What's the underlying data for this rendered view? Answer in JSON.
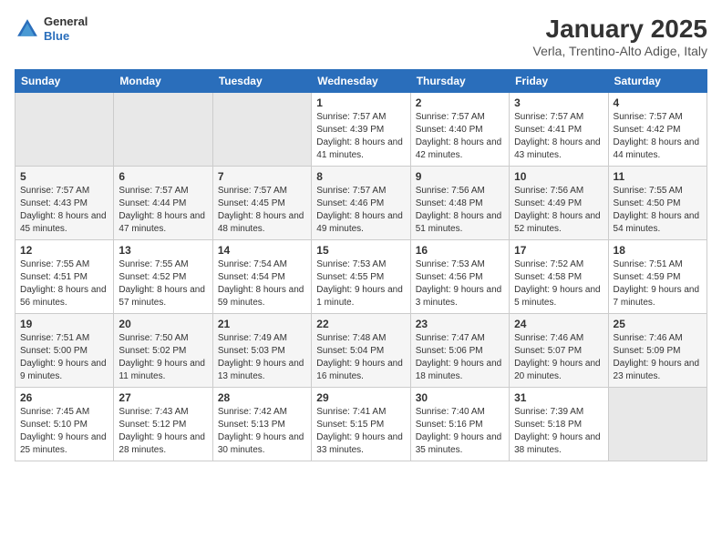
{
  "header": {
    "logo_line1": "General",
    "logo_line2": "Blue",
    "month": "January 2025",
    "location": "Verla, Trentino-Alto Adige, Italy"
  },
  "weekdays": [
    "Sunday",
    "Monday",
    "Tuesday",
    "Wednesday",
    "Thursday",
    "Friday",
    "Saturday"
  ],
  "weeks": [
    [
      {
        "day": "",
        "info": ""
      },
      {
        "day": "",
        "info": ""
      },
      {
        "day": "",
        "info": ""
      },
      {
        "day": "1",
        "info": "Sunrise: 7:57 AM\nSunset: 4:39 PM\nDaylight: 8 hours and 41 minutes."
      },
      {
        "day": "2",
        "info": "Sunrise: 7:57 AM\nSunset: 4:40 PM\nDaylight: 8 hours and 42 minutes."
      },
      {
        "day": "3",
        "info": "Sunrise: 7:57 AM\nSunset: 4:41 PM\nDaylight: 8 hours and 43 minutes."
      },
      {
        "day": "4",
        "info": "Sunrise: 7:57 AM\nSunset: 4:42 PM\nDaylight: 8 hours and 44 minutes."
      }
    ],
    [
      {
        "day": "5",
        "info": "Sunrise: 7:57 AM\nSunset: 4:43 PM\nDaylight: 8 hours and 45 minutes."
      },
      {
        "day": "6",
        "info": "Sunrise: 7:57 AM\nSunset: 4:44 PM\nDaylight: 8 hours and 47 minutes."
      },
      {
        "day": "7",
        "info": "Sunrise: 7:57 AM\nSunset: 4:45 PM\nDaylight: 8 hours and 48 minutes."
      },
      {
        "day": "8",
        "info": "Sunrise: 7:57 AM\nSunset: 4:46 PM\nDaylight: 8 hours and 49 minutes."
      },
      {
        "day": "9",
        "info": "Sunrise: 7:56 AM\nSunset: 4:48 PM\nDaylight: 8 hours and 51 minutes."
      },
      {
        "day": "10",
        "info": "Sunrise: 7:56 AM\nSunset: 4:49 PM\nDaylight: 8 hours and 52 minutes."
      },
      {
        "day": "11",
        "info": "Sunrise: 7:55 AM\nSunset: 4:50 PM\nDaylight: 8 hours and 54 minutes."
      }
    ],
    [
      {
        "day": "12",
        "info": "Sunrise: 7:55 AM\nSunset: 4:51 PM\nDaylight: 8 hours and 56 minutes."
      },
      {
        "day": "13",
        "info": "Sunrise: 7:55 AM\nSunset: 4:52 PM\nDaylight: 8 hours and 57 minutes."
      },
      {
        "day": "14",
        "info": "Sunrise: 7:54 AM\nSunset: 4:54 PM\nDaylight: 8 hours and 59 minutes."
      },
      {
        "day": "15",
        "info": "Sunrise: 7:53 AM\nSunset: 4:55 PM\nDaylight: 9 hours and 1 minute."
      },
      {
        "day": "16",
        "info": "Sunrise: 7:53 AM\nSunset: 4:56 PM\nDaylight: 9 hours and 3 minutes."
      },
      {
        "day": "17",
        "info": "Sunrise: 7:52 AM\nSunset: 4:58 PM\nDaylight: 9 hours and 5 minutes."
      },
      {
        "day": "18",
        "info": "Sunrise: 7:51 AM\nSunset: 4:59 PM\nDaylight: 9 hours and 7 minutes."
      }
    ],
    [
      {
        "day": "19",
        "info": "Sunrise: 7:51 AM\nSunset: 5:00 PM\nDaylight: 9 hours and 9 minutes."
      },
      {
        "day": "20",
        "info": "Sunrise: 7:50 AM\nSunset: 5:02 PM\nDaylight: 9 hours and 11 minutes."
      },
      {
        "day": "21",
        "info": "Sunrise: 7:49 AM\nSunset: 5:03 PM\nDaylight: 9 hours and 13 minutes."
      },
      {
        "day": "22",
        "info": "Sunrise: 7:48 AM\nSunset: 5:04 PM\nDaylight: 9 hours and 16 minutes."
      },
      {
        "day": "23",
        "info": "Sunrise: 7:47 AM\nSunset: 5:06 PM\nDaylight: 9 hours and 18 minutes."
      },
      {
        "day": "24",
        "info": "Sunrise: 7:46 AM\nSunset: 5:07 PM\nDaylight: 9 hours and 20 minutes."
      },
      {
        "day": "25",
        "info": "Sunrise: 7:46 AM\nSunset: 5:09 PM\nDaylight: 9 hours and 23 minutes."
      }
    ],
    [
      {
        "day": "26",
        "info": "Sunrise: 7:45 AM\nSunset: 5:10 PM\nDaylight: 9 hours and 25 minutes."
      },
      {
        "day": "27",
        "info": "Sunrise: 7:43 AM\nSunset: 5:12 PM\nDaylight: 9 hours and 28 minutes."
      },
      {
        "day": "28",
        "info": "Sunrise: 7:42 AM\nSunset: 5:13 PM\nDaylight: 9 hours and 30 minutes."
      },
      {
        "day": "29",
        "info": "Sunrise: 7:41 AM\nSunset: 5:15 PM\nDaylight: 9 hours and 33 minutes."
      },
      {
        "day": "30",
        "info": "Sunrise: 7:40 AM\nSunset: 5:16 PM\nDaylight: 9 hours and 35 minutes."
      },
      {
        "day": "31",
        "info": "Sunrise: 7:39 AM\nSunset: 5:18 PM\nDaylight: 9 hours and 38 minutes."
      },
      {
        "day": "",
        "info": ""
      }
    ]
  ]
}
